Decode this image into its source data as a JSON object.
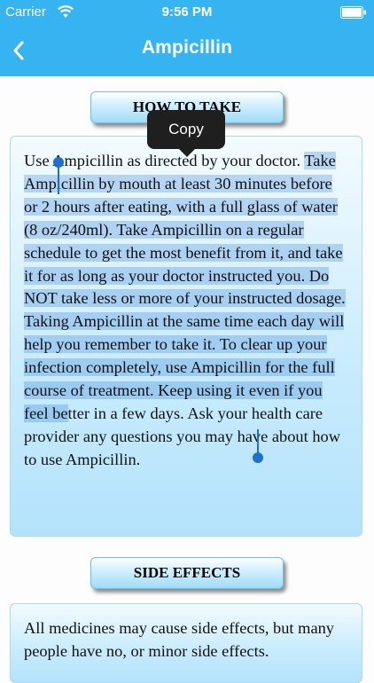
{
  "status_bar": {
    "carrier": "Carrier",
    "time": "9:56 PM",
    "wifi_icon": "wifi-icon",
    "battery_icon": "battery-icon"
  },
  "nav": {
    "back_icon": "chevron-left-icon",
    "title": "Ampicillin"
  },
  "sections": [
    {
      "header": "HOW TO TAKE",
      "text_before_selection": "Use Ampicillin as directed by your doctor. ",
      "text_selected": "Take Ampicillin by mouth at least 30 minutes before or 2 hours after eating, with a full glass of water (8 oz/240ml). Take Ampicillin on a regular schedule to get the most benefit from it, and take it for as long as your doctor instructed you. Do NOT take less or more of your instructed dosage. Taking Ampicillin at the same time each day will help you remember to take it. To clear up your infection completely, use Ampicillin for the full course of treatment. Keep using it even if you feel be",
      "text_after_selection": "tter in a few days. Ask your health care provider any questions you may have about how to use Ampicillin."
    },
    {
      "header": "SIDE EFFECTS",
      "text": "All medicines may cause side effects, but many people have no, or minor side effects."
    }
  ],
  "context_menu": {
    "copy_label": "Copy"
  },
  "colors": {
    "nav_background": "#35b4f1",
    "selection_handle": "#1f6fd0",
    "selection_highlight": "#2878d2"
  }
}
